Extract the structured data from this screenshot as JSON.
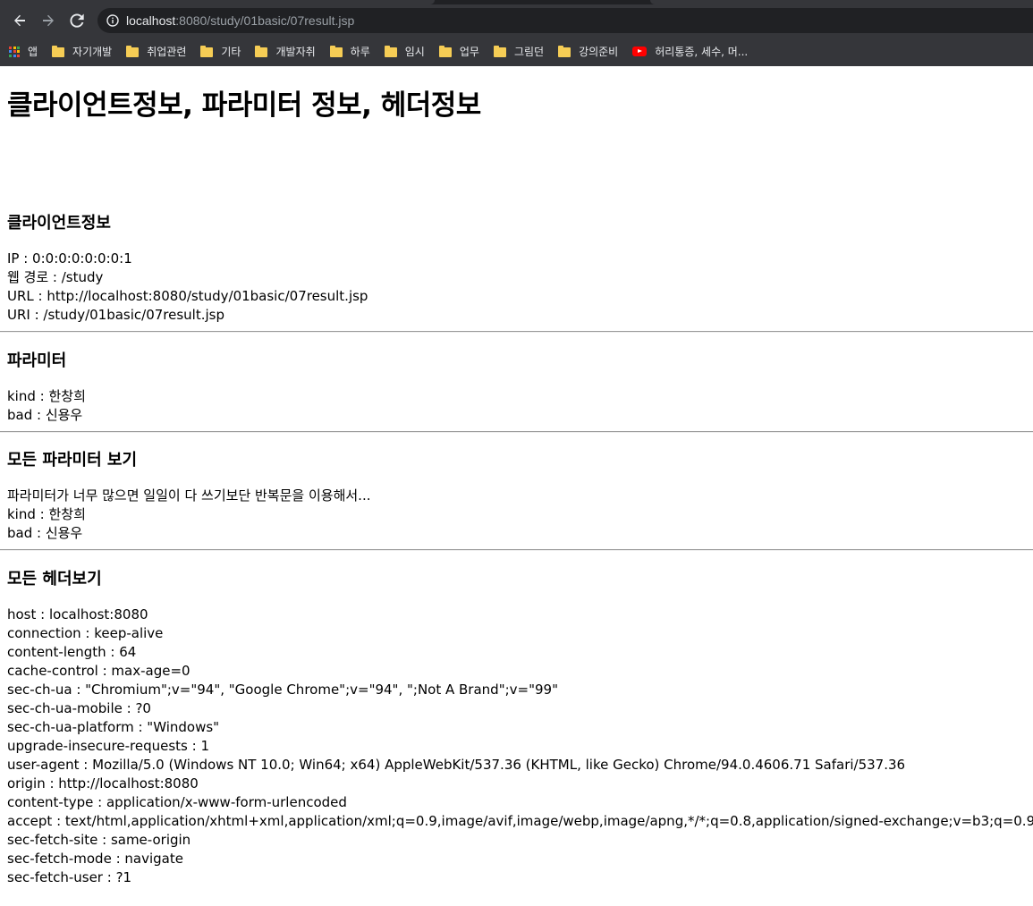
{
  "browser": {
    "address_bar": {
      "host": "localhost",
      "rest": ":8080/study/01basic/07result.jsp"
    },
    "bookmarks": [
      {
        "label": "앱",
        "icon": "apps-grid-icon"
      },
      {
        "label": "자기개발",
        "icon": "folder-icon"
      },
      {
        "label": "취업관련",
        "icon": "folder-icon"
      },
      {
        "label": "기타",
        "icon": "folder-icon"
      },
      {
        "label": "개발자취",
        "icon": "folder-icon"
      },
      {
        "label": "하루",
        "icon": "folder-icon"
      },
      {
        "label": "임시",
        "icon": "folder-icon"
      },
      {
        "label": "업무",
        "icon": "folder-icon"
      },
      {
        "label": "그림던",
        "icon": "folder-icon"
      },
      {
        "label": "강의준비",
        "icon": "folder-icon"
      },
      {
        "label": "허리통증, 세수, 머...",
        "icon": "youtube-icon"
      }
    ],
    "colors": {
      "chrome_dark": "#202124",
      "chrome_toolbar": "#35363a",
      "folder": "#f6cd55"
    }
  },
  "page": {
    "title": "클라이언트정보, 파라미터 정보, 헤더정보",
    "client_info": {
      "heading": "클라이언트정보",
      "lines": [
        "IP : 0:0:0:0:0:0:0:1",
        "웹 경로 : /study",
        "URL : http://localhost:8080/study/01basic/07result.jsp",
        "URI : /study/01basic/07result.jsp"
      ]
    },
    "parameters": {
      "heading": "파라미터",
      "lines": [
        "kind : 한창희",
        "bad : 신용우"
      ]
    },
    "all_parameters": {
      "heading": "모든 파라미터 보기",
      "lines": [
        "파라미터가 너무 많으면 일일이 다 쓰기보단 반복문을 이용해서...",
        "kind : 한창희",
        "bad : 신용우"
      ]
    },
    "all_headers": {
      "heading": "모든 헤더보기",
      "lines": [
        "host : localhost:8080",
        "connection : keep-alive",
        "content-length : 64",
        "cache-control : max-age=0",
        "sec-ch-ua : \"Chromium\";v=\"94\", \"Google Chrome\";v=\"94\", \";Not A Brand\";v=\"99\"",
        "sec-ch-ua-mobile : ?0",
        "sec-ch-ua-platform : \"Windows\"",
        "upgrade-insecure-requests : 1",
        "user-agent : Mozilla/5.0 (Windows NT 10.0; Win64; x64) AppleWebKit/537.36 (KHTML, like Gecko) Chrome/94.0.4606.71 Safari/537.36",
        "origin : http://localhost:8080",
        "content-type : application/x-www-form-urlencoded",
        "accept : text/html,application/xhtml+xml,application/xml;q=0.9,image/avif,image/webp,image/apng,*/*;q=0.8,application/signed-exchange;v=b3;q=0.9",
        "sec-fetch-site : same-origin",
        "sec-fetch-mode : navigate",
        "sec-fetch-user : ?1"
      ]
    }
  }
}
